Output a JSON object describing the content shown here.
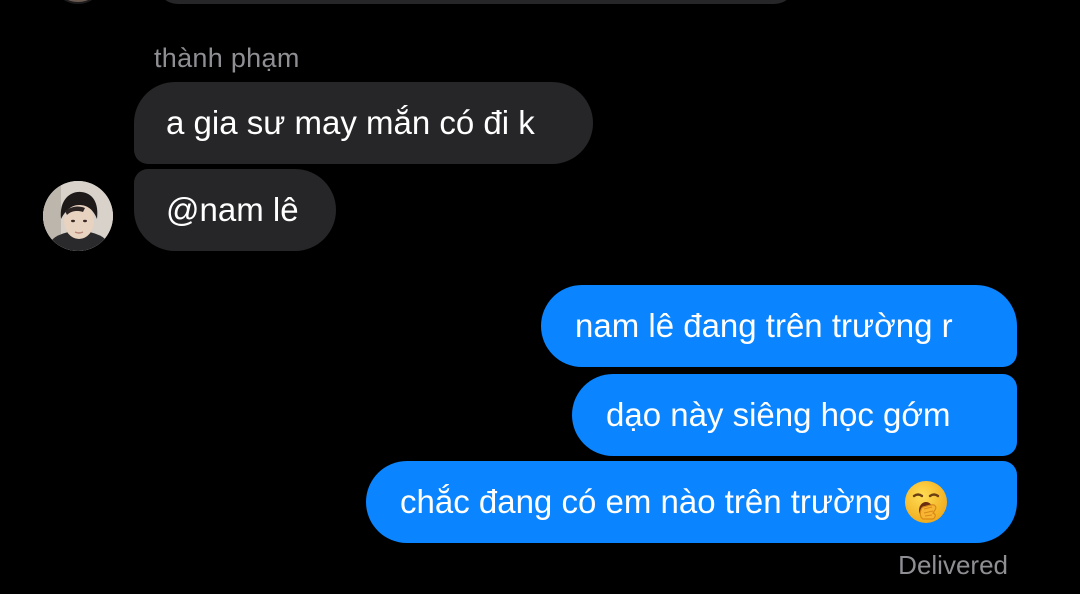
{
  "thread": {
    "sender_name": "thành phạm",
    "incoming": [
      {
        "text": "a gia sư may mắn có đi k"
      },
      {
        "text": "@nam lê"
      }
    ],
    "outgoing": [
      {
        "text": "nam lê đang trên trường r"
      },
      {
        "text": "dạo này siêng học gớm"
      },
      {
        "text": "chắc đang có em nào trên trường",
        "emoji": "yawning-face-emoji"
      }
    ],
    "status": "Delivered"
  },
  "colors": {
    "background": "#000000",
    "incoming_bubble": "#262628",
    "outgoing_bubble": "#0a84ff",
    "meta_text": "#8e8e93"
  },
  "icons": {
    "avatar": "user-avatar-photo",
    "emoji": "yawning-face-emoji"
  }
}
